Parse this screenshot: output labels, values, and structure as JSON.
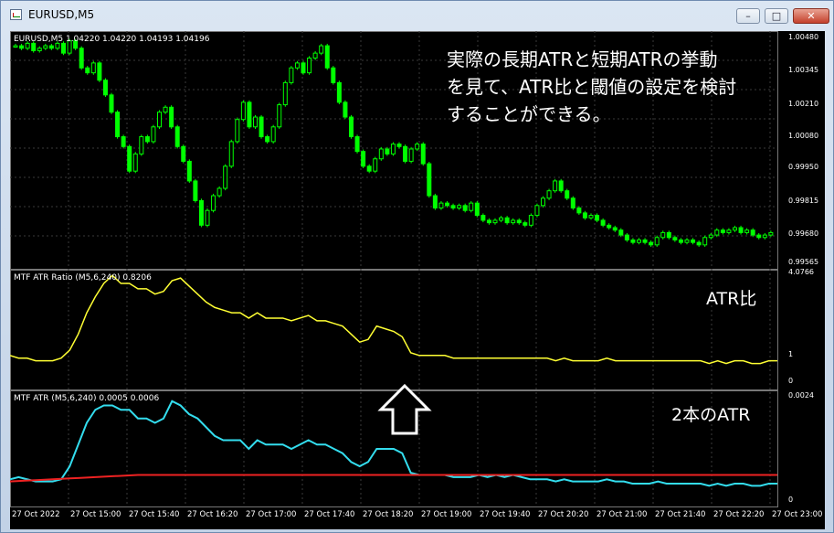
{
  "window": {
    "title": "EURUSD,M5",
    "min_icon": "minimize-icon",
    "max_icon": "maximize-icon",
    "close_icon": "close-icon"
  },
  "price_panel": {
    "header": "EURUSD,M5  1.04220 1.04220 1.04193 1.04196",
    "annotation": [
      "実際の長期ATRと短期ATRの挙動",
      "を見て、ATR比と閾値の設定を検討",
      "することができる。"
    ],
    "colors": {
      "bull": "#00ff00",
      "bear": "#00ff00",
      "grid": "#3a3a3a"
    }
  },
  "ratio_panel": {
    "header": "MTF ATR Ratio  (M5,6,240) 0.8206",
    "label": "ATR比",
    "color": "#ffff33"
  },
  "atr_panel": {
    "header": "MTF ATR  (M5,6,240) 0.0005 0.0006",
    "label": "2本のATR",
    "colors": {
      "short": "#33ddee",
      "long": "#ee2222"
    }
  },
  "chart_data": [
    {
      "type": "candlestick",
      "title": "EURUSD,M5",
      "ylim": [
        0.99565,
        1.0048
      ],
      "y_ticks": [
        "1.00480",
        "1.00345",
        "1.00210",
        "1.00080",
        "0.99950",
        "0.99815",
        "0.99680",
        "0.99565"
      ],
      "x_ticks": [
        "27 Oct 2022",
        "27 Oct 15:00",
        "27 Oct 15:40",
        "27 Oct 16:20",
        "27 Oct 17:00",
        "27 Oct 17:40",
        "27 Oct 18:20",
        "27 Oct 19:00",
        "27 Oct 19:40",
        "27 Oct 20:20",
        "27 Oct 21:00",
        "27 Oct 21:40",
        "27 Oct 22:20",
        "27 Oct 23:00"
      ],
      "close": [
        1.0045,
        1.0044,
        1.0046,
        1.0043,
        1.0044,
        1.0045,
        1.0044,
        1.0046,
        1.0042,
        1.0047,
        1.0044,
        1.0036,
        1.0034,
        1.0038,
        1.0031,
        1.0025,
        1.0018,
        1.0008,
        1.0004,
        0.9994,
        1.0001,
        1.0008,
        1.0006,
        1.0012,
        1.0018,
        1.002,
        1.0012,
        1.0004,
        0.9998,
        0.999,
        0.9982,
        0.9972,
        0.9978,
        0.9984,
        0.9987,
        0.9996,
        1.0006,
        1.0015,
        1.0022,
        1.0012,
        1.0016,
        1.0008,
        1.0006,
        1.0012,
        1.0021,
        1.003,
        1.0036,
        1.0038,
        1.0034,
        1.004,
        1.0042,
        1.0045,
        1.0036,
        1.003,
        1.0022,
        1.0016,
        1.0008,
        1.0002,
        0.9996,
        0.9994,
        0.9999,
        1.0003,
        1.0001,
        1.0005,
        1.0004,
        0.9998,
        1.0003,
        1.0005,
        0.9997,
        0.9984,
        0.9979,
        0.9981,
        0.998,
        0.9979,
        0.998,
        0.9978,
        0.9981,
        0.9976,
        0.9974,
        0.9973,
        0.9974,
        0.9975,
        0.9973,
        0.9974,
        0.9973,
        0.9972,
        0.9976,
        0.998,
        0.9983,
        0.9986,
        0.999,
        0.9986,
        0.9983,
        0.9979,
        0.9977,
        0.9975,
        0.9976,
        0.9974,
        0.9972,
        0.9971,
        0.997,
        0.9968,
        0.9966,
        0.9965,
        0.9966,
        0.9965,
        0.9964,
        0.9967,
        0.9969,
        0.9967,
        0.9966,
        0.9965,
        0.9966,
        0.9965,
        0.9964,
        0.9967,
        0.9968,
        0.997,
        0.9969,
        0.997,
        0.9971,
        0.9969,
        0.997,
        0.9968,
        0.9967,
        0.9968,
        0.9969
      ]
    },
    {
      "type": "line",
      "title": "MTF ATR Ratio (M5,6,240) 0.8206",
      "ylim": [
        0,
        4.0766
      ],
      "y_ticks": [
        "4.0766",
        "1",
        "0"
      ],
      "series": [
        {
          "name": "ATR比",
          "values": [
            1.0,
            0.9,
            0.9,
            0.8,
            0.8,
            0.8,
            0.9,
            1.2,
            1.8,
            2.6,
            3.2,
            3.7,
            4.0,
            3.7,
            3.7,
            3.5,
            3.5,
            3.3,
            3.4,
            3.8,
            3.9,
            3.6,
            3.3,
            3.0,
            2.8,
            2.7,
            2.6,
            2.6,
            2.4,
            2.6,
            2.4,
            2.4,
            2.4,
            2.3,
            2.4,
            2.5,
            2.3,
            2.3,
            2.2,
            2.1,
            1.8,
            1.5,
            1.6,
            2.1,
            2.0,
            1.9,
            1.7,
            1.1,
            1.0,
            1.0,
            1.0,
            1.0,
            0.9,
            0.9,
            0.9,
            0.9,
            0.9,
            0.9,
            0.9,
            0.9,
            0.9,
            0.9,
            0.9,
            0.9,
            0.8,
            0.9,
            0.8,
            0.8,
            0.8,
            0.8,
            0.9,
            0.8,
            0.8,
            0.8,
            0.8,
            0.8,
            0.8,
            0.8,
            0.8,
            0.8,
            0.8,
            0.8,
            0.7,
            0.8,
            0.7,
            0.8,
            0.8,
            0.7,
            0.7,
            0.8,
            0.8
          ]
        }
      ]
    },
    {
      "type": "line",
      "title": "MTF ATR (M5,6,240) 0.0005 0.0006",
      "ylim": [
        0,
        0.0024
      ],
      "y_ticks": [
        "0.0024",
        "0"
      ],
      "series": [
        {
          "name": "short",
          "values": [
            0.0005,
            0.00055,
            0.0005,
            0.00045,
            0.00045,
            0.00045,
            0.0005,
            0.0008,
            0.0013,
            0.0018,
            0.0021,
            0.0022,
            0.0022,
            0.0021,
            0.0021,
            0.0019,
            0.0019,
            0.0018,
            0.0019,
            0.0023,
            0.0022,
            0.002,
            0.0019,
            0.0017,
            0.0015,
            0.0014,
            0.0014,
            0.0014,
            0.0012,
            0.0014,
            0.0013,
            0.0013,
            0.0013,
            0.0012,
            0.0013,
            0.0014,
            0.0013,
            0.0013,
            0.0012,
            0.0011,
            0.0009,
            0.0008,
            0.0009,
            0.0012,
            0.0012,
            0.0012,
            0.0011,
            0.00065,
            0.0006,
            0.0006,
            0.0006,
            0.0006,
            0.00055,
            0.00055,
            0.00055,
            0.0006,
            0.00055,
            0.0006,
            0.00055,
            0.0006,
            0.00055,
            0.0005,
            0.0005,
            0.0005,
            0.00045,
            0.0005,
            0.00045,
            0.00045,
            0.00045,
            0.00045,
            0.0005,
            0.00045,
            0.00045,
            0.0004,
            0.0004,
            0.0004,
            0.00045,
            0.0004,
            0.0004,
            0.0004,
            0.0004,
            0.0004,
            0.00035,
            0.0004,
            0.00035,
            0.0004,
            0.0004,
            0.00035,
            0.00035,
            0.0004,
            0.0004
          ]
        },
        {
          "name": "long",
          "values": [
            0.00045,
            0.00046,
            0.00047,
            0.00048,
            0.00049,
            0.0005,
            0.00051,
            0.00052,
            0.00053,
            0.00054,
            0.00055,
            0.00056,
            0.00057,
            0.00058,
            0.00059,
            0.0006,
            0.0006,
            0.0006,
            0.0006,
            0.0006,
            0.0006,
            0.0006,
            0.0006,
            0.0006,
            0.0006,
            0.0006,
            0.0006,
            0.0006,
            0.0006,
            0.0006,
            0.0006,
            0.0006,
            0.0006,
            0.0006,
            0.0006,
            0.0006,
            0.0006,
            0.0006,
            0.0006,
            0.0006,
            0.0006,
            0.0006,
            0.0006,
            0.0006,
            0.0006,
            0.0006,
            0.0006,
            0.0006,
            0.0006,
            0.0006,
            0.0006,
            0.0006,
            0.0006,
            0.0006,
            0.0006,
            0.0006,
            0.0006,
            0.0006,
            0.0006,
            0.0006,
            0.0006,
            0.0006,
            0.0006,
            0.0006,
            0.0006,
            0.0006,
            0.0006,
            0.0006,
            0.0006,
            0.0006,
            0.0006,
            0.0006,
            0.0006,
            0.0006,
            0.0006,
            0.0006,
            0.0006,
            0.0006,
            0.0006,
            0.0006,
            0.0006,
            0.0006,
            0.0006,
            0.0006,
            0.0006,
            0.0006,
            0.0006,
            0.0006,
            0.0006,
            0.0006,
            0.0006
          ]
        }
      ]
    }
  ]
}
